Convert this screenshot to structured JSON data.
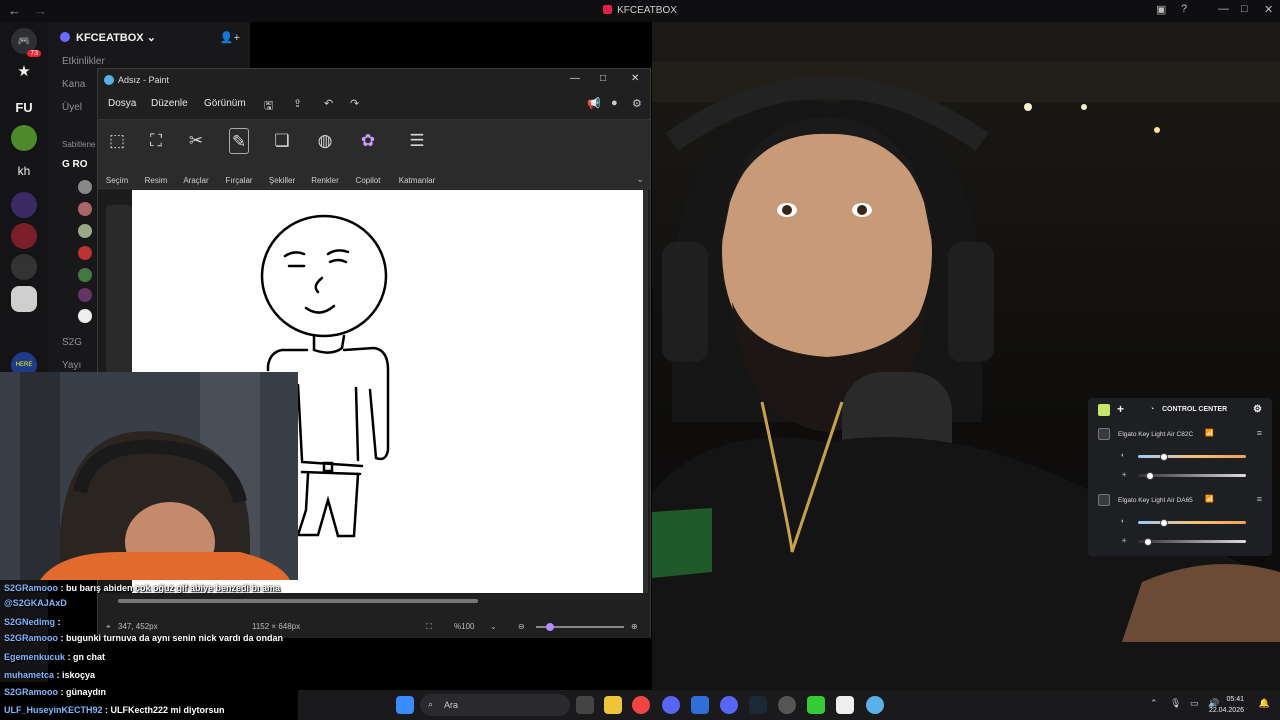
{
  "host": {
    "title": "KFCEATBOX",
    "back": "←",
    "forward": "→"
  },
  "rail": {
    "badge": "73",
    "kh": "kh",
    "fu": "FU"
  },
  "channels": {
    "guild": "KFCEATBOX",
    "events": "Etkinlikler",
    "kanal": "Kana",
    "uyeler": "Üyel",
    "sabitlenen": "Sabitlene",
    "g_ro": "G RO",
    "s2g": "S2G",
    "yayi": "Yayı"
  },
  "paint": {
    "title": "Adsız - Paint",
    "menu": [
      "Dosya",
      "Düzenle",
      "Görünüm"
    ],
    "tools": [
      "Seçim",
      "Resim",
      "Araçlar",
      "Fırçalar",
      "Şekiller",
      "Renkler",
      "Copilot",
      "Katmanlar"
    ],
    "status": {
      "cursor": "347, 452px",
      "size": "1152 × 648px",
      "zoom": "%100"
    }
  },
  "control_center": {
    "title": "CONTROL CENTER",
    "devices": [
      {
        "name": "Elgato Key Light Air C82C",
        "brightness": 0.25,
        "temperature": 0.12
      },
      {
        "name": "Elgato Key Light Air DA65",
        "brightness": 0.25,
        "temperature": 0.1
      }
    ]
  },
  "chat": {
    "lines": [
      {
        "user": "S2GRamooo",
        "msg": " : bu barış abiden çok oğuz gif abiye benzedi bı ama"
      },
      {
        "user": "@S2GKAJAxD",
        "msg": ""
      },
      {
        "user": "S2GNedimg",
        "msg": " :"
      },
      {
        "user": "S2GRamooo",
        "msg": " : bugunki turnuva da aynı senin nick vardı da ondan"
      },
      {
        "user": "Egemenkucuk",
        "msg": " : gn chat"
      },
      {
        "user": "muhametca",
        "msg": " : iskoçya"
      },
      {
        "user": "S2GRamooo",
        "msg": " : günaydın"
      },
      {
        "user": "ULF_HuseyinKECTH92",
        "msg": " : ULFKecth222 mi diytorsun"
      }
    ]
  },
  "taskbar": {
    "search": "Ara",
    "time": "05:41",
    "date": "22.04.2026"
  },
  "colors": {
    "accent": "#6b6bff",
    "cc_bar_warm": "#f4a15a",
    "cc_bar_cool": "#9cc9ff"
  }
}
